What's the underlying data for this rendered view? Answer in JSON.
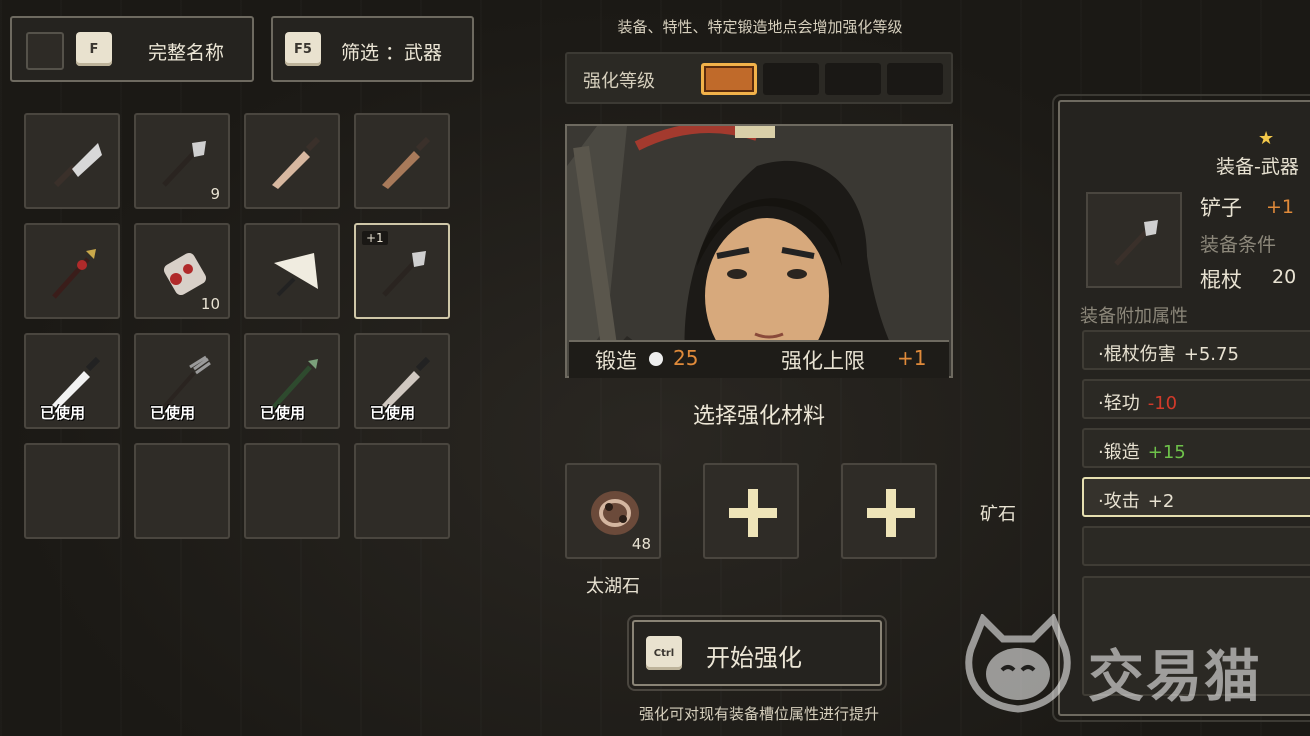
{
  "header": {
    "name_toggle": {
      "key": "F",
      "label": "完整名称"
    },
    "filter": {
      "key": "F5",
      "label": "筛选 ：武器"
    }
  },
  "inventory": {
    "slots": [
      {
        "icon": "cleaver-icon",
        "count": "",
        "used": "",
        "badge": ""
      },
      {
        "icon": "spade-icon",
        "count": "9",
        "used": "",
        "badge": ""
      },
      {
        "icon": "dagger-icon",
        "count": "",
        "used": "",
        "badge": ""
      },
      {
        "icon": "short-sword-icon",
        "count": "",
        "used": "",
        "badge": ""
      },
      {
        "icon": "red-tassel-spear-icon",
        "count": "",
        "used": "",
        "badge": ""
      },
      {
        "icon": "scroll-icon",
        "count": "10",
        "used": "",
        "badge": ""
      },
      {
        "icon": "fan-icon",
        "count": "",
        "used": "",
        "badge": ""
      },
      {
        "icon": "spade-icon",
        "count": "",
        "used": "",
        "badge": "+1"
      },
      {
        "icon": "white-sword-icon",
        "count": "",
        "used": "已使用",
        "badge": ""
      },
      {
        "icon": "trident-icon",
        "count": "",
        "used": "已使用",
        "badge": ""
      },
      {
        "icon": "green-spear-icon",
        "count": "",
        "used": "已使用",
        "badge": ""
      },
      {
        "icon": "sword-icon",
        "count": "",
        "used": "已使用",
        "badge": ""
      },
      {
        "icon": "",
        "count": "",
        "used": "",
        "badge": ""
      },
      {
        "icon": "",
        "count": "",
        "used": "",
        "badge": ""
      },
      {
        "icon": "",
        "count": "",
        "used": "",
        "badge": ""
      },
      {
        "icon": "",
        "count": "",
        "used": "",
        "badge": ""
      }
    ],
    "selected_index": 7
  },
  "forge": {
    "hint_top": "装备、特性、特定锻造地点会增加强化等级",
    "level_label": "强化等级",
    "level_current": 1,
    "level_max": 4,
    "forge_label": "锻造",
    "forge_value": "25",
    "cap_label": "强化上限",
    "cap_value": "+1",
    "select_material": "选择强化材料",
    "material": {
      "name": "太湖石",
      "count": "48"
    },
    "ore_label": "矿石",
    "start_key": "Ctrl",
    "start_label": "开始强化",
    "footer_hint": "强化可对现有装备槽位属性进行提升"
  },
  "detail": {
    "title": "装备-武器",
    "item_name": "铲子",
    "item_plus": "+1",
    "req_label": "装备条件",
    "req_type": "棍杖",
    "req_value": "20",
    "attr_head": "装备附加属性",
    "attributes": [
      {
        "name": "·棍杖伤害",
        "value": "+5.75",
        "tone": "neutral"
      },
      {
        "name": "·轻功",
        "value": "-10",
        "tone": "neg"
      },
      {
        "name": "·锻造",
        "value": "+15",
        "tone": "pos"
      },
      {
        "name": "·攻击",
        "value": "+2",
        "tone": "neutral"
      },
      {
        "name": "",
        "value": "",
        "tone": "neutral"
      }
    ],
    "selected_attr": 3
  },
  "watermark": {
    "text": "交易猫"
  },
  "colors": {
    "accent": "#e08a3a",
    "negative": "#d23a2a",
    "positive": "#6ec24a",
    "highlight": "#f2b24a"
  }
}
